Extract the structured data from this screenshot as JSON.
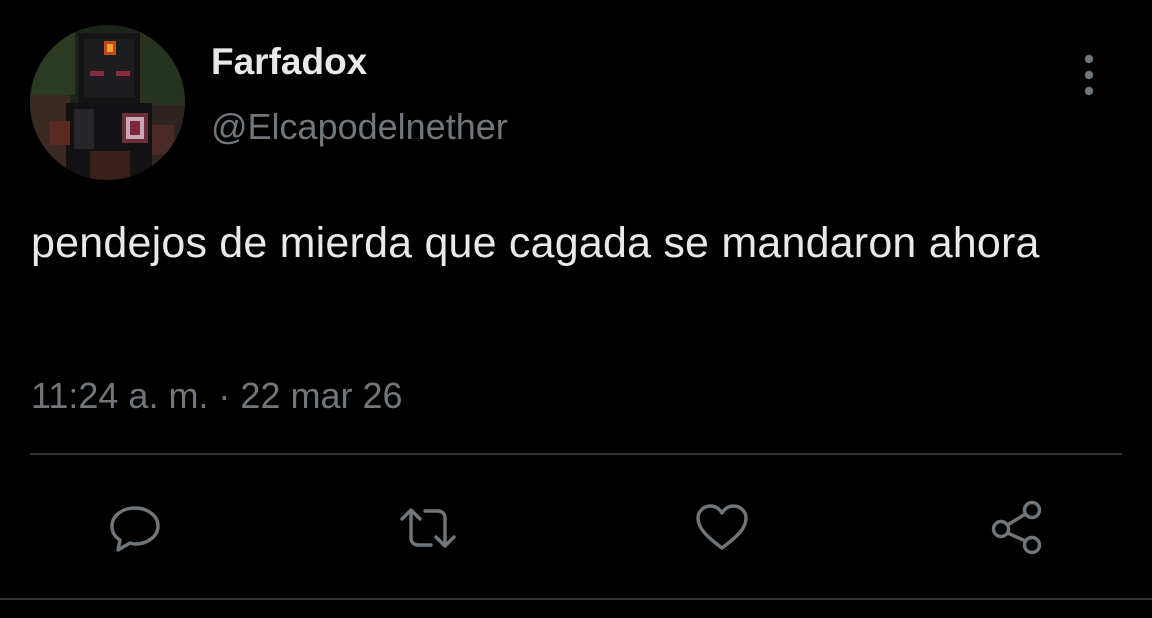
{
  "tweet": {
    "display_name": "Farfadox",
    "handle": "@Elcapodelnether",
    "text": "pendejos de mierda que cagada se mandaron ahora",
    "timestamp": "11:24 a. m. · 22 mar 26"
  },
  "icons": {
    "more": "more-vertical-icon",
    "reply": "reply-bubble-icon",
    "retweet": "retweet-icon",
    "like": "heart-icon",
    "share": "share-nodes-icon"
  },
  "colors": {
    "background": "#000000",
    "primary_text": "#e7e9ea",
    "secondary_text": "#71767b",
    "divider": "#2f3336"
  }
}
